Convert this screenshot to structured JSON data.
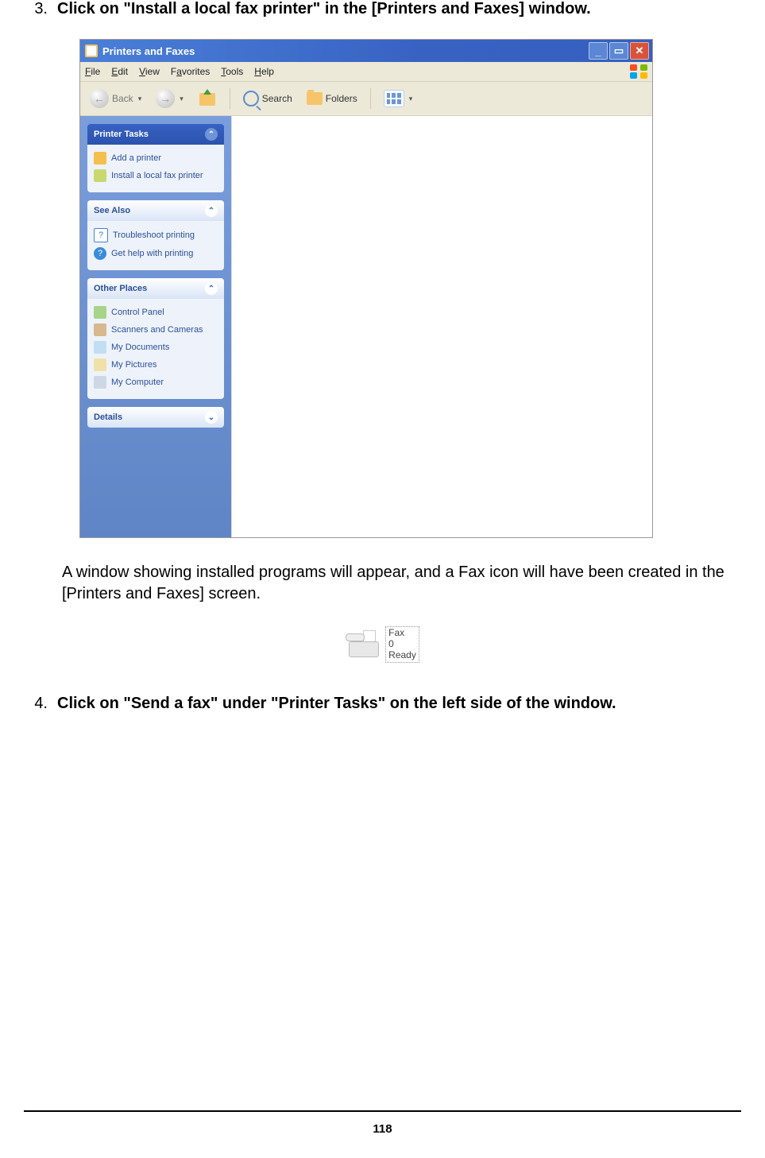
{
  "steps": {
    "s3": {
      "num": "3.",
      "text": "Click on \"Install a local fax printer\" in the [Printers and Faxes] window."
    },
    "s4": {
      "num": "4.",
      "text": "Click on \"Send a fax\" under \"Printer Tasks\" on the left side of the window."
    }
  },
  "window": {
    "title": "Printers and Faxes",
    "menubar": {
      "file": "File",
      "edit": "Edit",
      "view": "View",
      "favorites": "Favorites",
      "tools": "Tools",
      "help": "Help"
    },
    "toolbar": {
      "back": "Back",
      "search": "Search",
      "folders": "Folders"
    },
    "sidebar": {
      "printerTasks": {
        "title": "Printer Tasks",
        "items": {
          "add": "Add a printer",
          "install": "Install a local fax printer"
        }
      },
      "seeAlso": {
        "title": "See Also",
        "items": {
          "troubleshoot": "Troubleshoot printing",
          "help": "Get help with printing"
        }
      },
      "otherPlaces": {
        "title": "Other Places",
        "items": {
          "cp": "Control Panel",
          "scan": "Scanners and Cameras",
          "docs": "My Documents",
          "pics": "My Pictures",
          "comp": "My Computer"
        }
      },
      "details": {
        "title": "Details"
      }
    }
  },
  "result_note": "A window showing installed programs will appear, and a Fax icon will have been created in the [Printers and Faxes] screen.",
  "fax_icon": {
    "name": "Fax",
    "line2": "0",
    "status": "Ready"
  },
  "page_number": "118"
}
